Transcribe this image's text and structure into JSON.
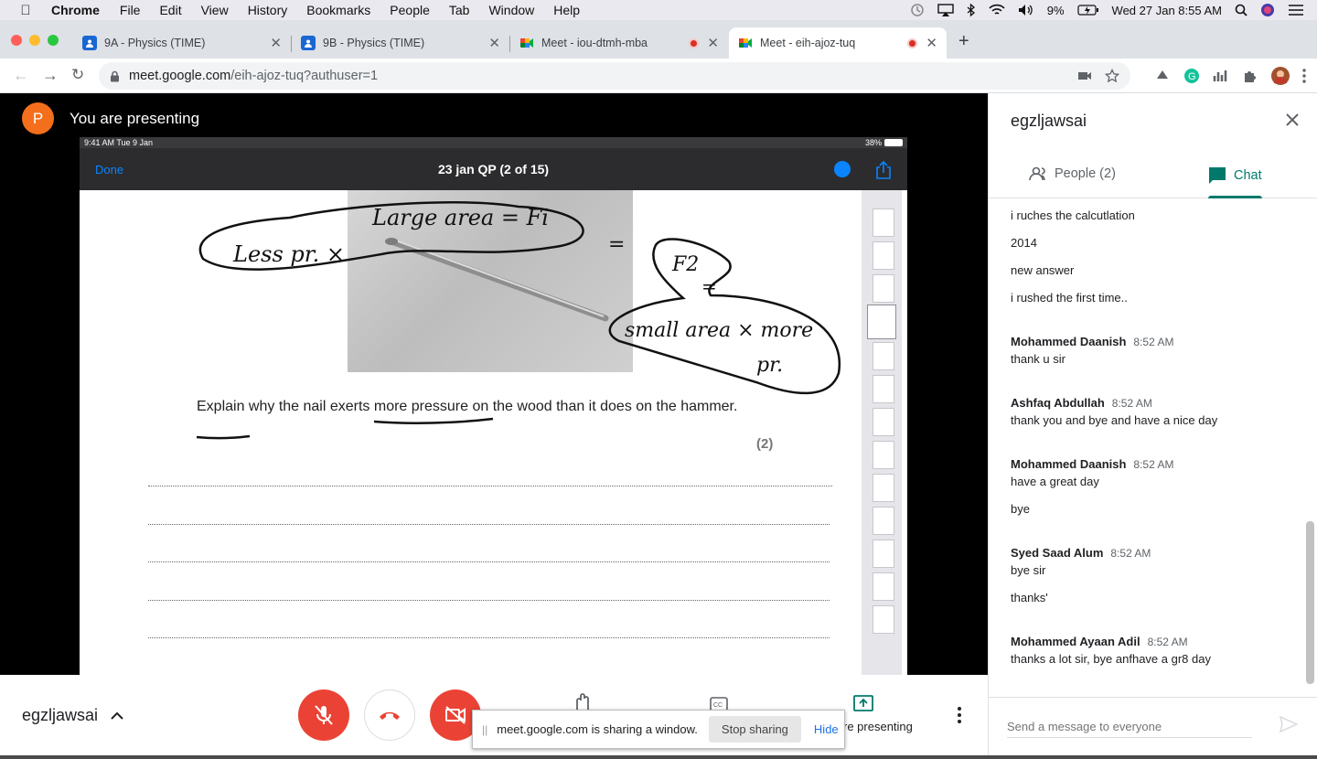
{
  "menubar": {
    "app": "Chrome",
    "items": [
      "File",
      "Edit",
      "View",
      "History",
      "Bookmarks",
      "People",
      "Tab",
      "Window",
      "Help"
    ],
    "battery": "9%",
    "datetime": "Wed 27 Jan  8:55 AM"
  },
  "tabs": [
    {
      "title": "9A - Physics (TIME)",
      "active": false
    },
    {
      "title": "9B - Physics (TIME)",
      "active": false
    },
    {
      "title": "Meet - iou-dtmh-mba",
      "active": false,
      "recording": true
    },
    {
      "title": "Meet - eih-ajoz-tuq",
      "active": true,
      "recording": true
    }
  ],
  "address": {
    "host": "meet.google.com",
    "path": "/eih-ajoz-tuq?authuser=1"
  },
  "presenting": {
    "avatar_letter": "P",
    "label": "You are presenting"
  },
  "ipad": {
    "status_time": "9:41 AM   Tue 9 Jan",
    "battery": "38%",
    "done": "Done",
    "doc_title": "23 jan QP (2 of 15)",
    "question": "Explain why the nail exerts more pressure on the wood than it does on the hammer.",
    "marks": "(2)"
  },
  "panel": {
    "title": "egzljawsai",
    "tab_people": "People (2)",
    "tab_chat": "Chat",
    "composer_placeholder": "Send a message to everyone"
  },
  "messages": [
    {
      "text": "i ruches the calcutlation"
    },
    {
      "text": "2014"
    },
    {
      "text": "new answer"
    },
    {
      "text": "i rushed the first time.."
    },
    {
      "sender": "Mohammed Daanish",
      "time": "8:52 AM"
    },
    {
      "text": "thank u sir"
    },
    {
      "sender": "Ashfaq Abdullah",
      "time": "8:52 AM"
    },
    {
      "text": "thank you and bye and have a  nice day"
    },
    {
      "sender": "Mohammed Daanish",
      "time": "8:52 AM"
    },
    {
      "text": "have a great day"
    },
    {
      "text": "bye"
    },
    {
      "sender": "Syed Saad Alum",
      "time": "8:52 AM"
    },
    {
      "text": "bye sir"
    },
    {
      "text": "thanks'"
    },
    {
      "sender": "Mohammed Ayaan Adil",
      "time": "8:52 AM"
    },
    {
      "text": "thanks a lot sir, bye anfhave a gr8 day"
    }
  ],
  "bottom": {
    "meeting": "egzljawsai",
    "presenting_label": "re presenting"
  },
  "share_bar": {
    "message": "meet.google.com is sharing a window.",
    "stop": "Stop sharing",
    "hide": "Hide"
  },
  "colors": {
    "meet_green": "#00796b",
    "danger": "#ea4335",
    "avatar": "#f46f1b"
  }
}
